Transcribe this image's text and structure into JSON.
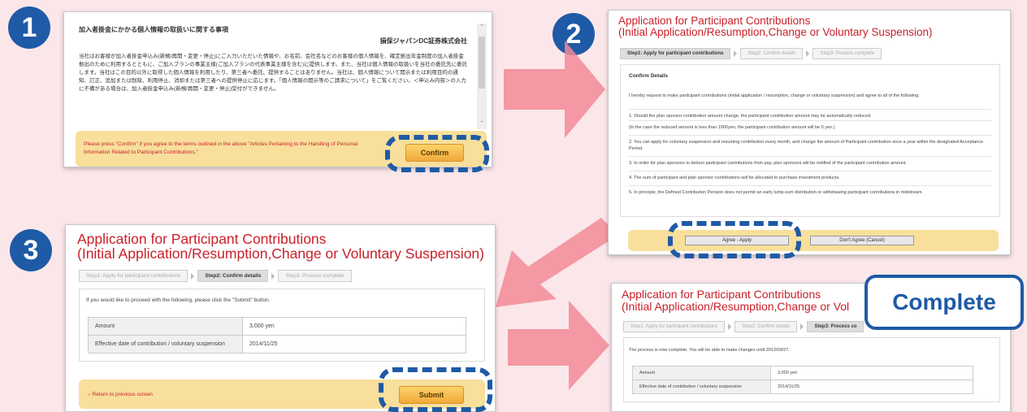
{
  "badges": {
    "one": "1",
    "two": "2",
    "three": "3",
    "complete": "Complete"
  },
  "colors": {
    "badge_blue": "#1f5aa6",
    "title_red": "#c9202a",
    "notice_bg": "#f8df9b",
    "arrow_pink": "#f07a8a",
    "button_orange": "#f1a93a"
  },
  "panel1": {
    "heading": "加入者掛金にかかる個人情報の取扱いに関する事項",
    "company": "損保ジャパンDC証券株式会社",
    "body": "当社はお客様が加入者掛金申込み(新規/再開・変更・停止)にご入力いただいた情報や、お名前、会社名などのお客様の個人情報を、確定拠出年金制度の加入者掛金拠出のために利用するとともに、ご加入プランの事業主様(ご加入プランの代表事業主様を含む)に提供します。また、当社は個人情報の取扱いを当社の委託先に委託します。当社はこの目的以外に取得した個人情報を利用したり、第三者へ委託、提供することはありません。当社は、個人情報について開示または利用目的の通知、訂正、追加または削除、利用停止、消却または第三者への提供停止に応じます。「個人情報の開示等のご請求について」をご覧ください。＜申込み内容＞の入力に不備がある場合は、加入者掛金申込み(新規/再開・変更・停止)受付ができません。",
    "notice": "Please press \"Confirm\" if you agree to the terms outlined in the above \"Articles Pertaining to the Handling of Personal Information Related to Participant Contributions.\"",
    "confirm_label": "Confirm"
  },
  "app_title_line1": "Application for Participant Contributions",
  "app_title_line2": "(Initial Application/Resumption,Change or Voluntary Suspension)",
  "app_title_line2_cut": "(Initial Application/Resumption,Change or Vol",
  "steps": {
    "s1": "Step1: Apply for participant contributions",
    "s2": "Step2: Confirm details",
    "s3": "Step3: Process complete",
    "s3_cut": "Step3: Process co"
  },
  "panel2": {
    "confirm_heading": "Confirm Details",
    "intro": "I hereby request to make participant contributions (initial application / resumption, change or voluntary suspension) and agree to all of the following:",
    "items": [
      "1. Should the plan sponsor contribution amount change, the participant contribution amount may be automatically reduced.",
      "(In the case the reduced amount is less than 1000yen, the participant contribution amount will be 0 yen.)",
      "2. You can apply for voluntary suspension and resuming contribution every month, and change the amount of Participant contribution once a year within the designated Acceptance Period.",
      "3. In order for plan sponsors to deduct participant contributions from pay, plan sponsors will be notified of the participant contribution amount.",
      "4. The sum of participant and plan sponsor contributions will be allocated to purchase investment products.",
      "5. In principle, the Defined Contribution Pension does not permit an early lump-sum distribution or withdrawing participant contributions in midstream."
    ],
    "agree_label": "Agree - Apply",
    "disagree_label": "Don't Agree (Cancel)"
  },
  "panel3": {
    "instruction": "If you would like to proceed with the following, please click the \"Submit\" button.",
    "rows": [
      {
        "k": "Amount",
        "v": "3,000 yen"
      },
      {
        "k": "Effective date of contribution / voluntary suspension",
        "v": "2014/11/25"
      }
    ],
    "back_label": "←Return to previous screen",
    "submit_label": "Submit"
  },
  "panel4": {
    "message": "The process is now complete. You will be able to make changes until 2012/09/27.",
    "rows": [
      {
        "k": "Amount",
        "v": "3,000 yen"
      },
      {
        "k": "Effective date of contribution / voluntary suspension",
        "v": "2014/11/25"
      }
    ]
  }
}
